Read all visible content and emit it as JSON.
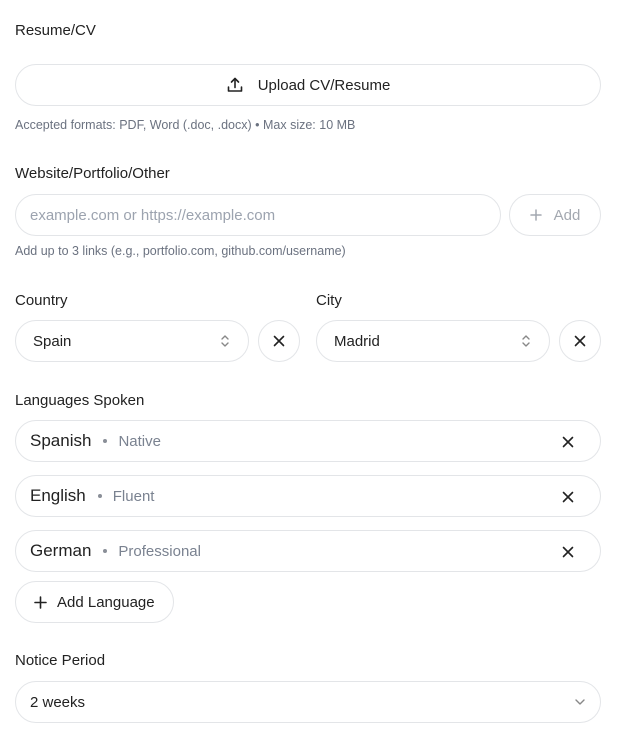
{
  "resume": {
    "label": "Resume/CV",
    "upload_label": "Upload CV/Resume",
    "hint": "Accepted formats: PDF, Word (.doc, .docx) • Max size: 10 MB"
  },
  "website": {
    "label": "Website/Portfolio/Other",
    "placeholder": "example.com or https://example.com",
    "value": "",
    "add_label": "Add",
    "hint": "Add up to 3 links (e.g., portfolio.com, github.com/username)"
  },
  "location": {
    "country_label": "Country",
    "country_value": "Spain",
    "city_label": "City",
    "city_value": "Madrid"
  },
  "languages": {
    "label": "Languages Spoken",
    "items": [
      {
        "name": "Spanish",
        "level": "Native"
      },
      {
        "name": "English",
        "level": "Fluent"
      },
      {
        "name": "German",
        "level": "Professional"
      }
    ],
    "add_label": "Add Language"
  },
  "notice": {
    "label": "Notice Period",
    "value": "2 weeks"
  },
  "icons": {
    "upload": "upload-icon",
    "plus": "plus-icon",
    "clear": "close-icon",
    "select": "chevron-up-down-icon",
    "dropdown": "chevron-down-icon"
  }
}
